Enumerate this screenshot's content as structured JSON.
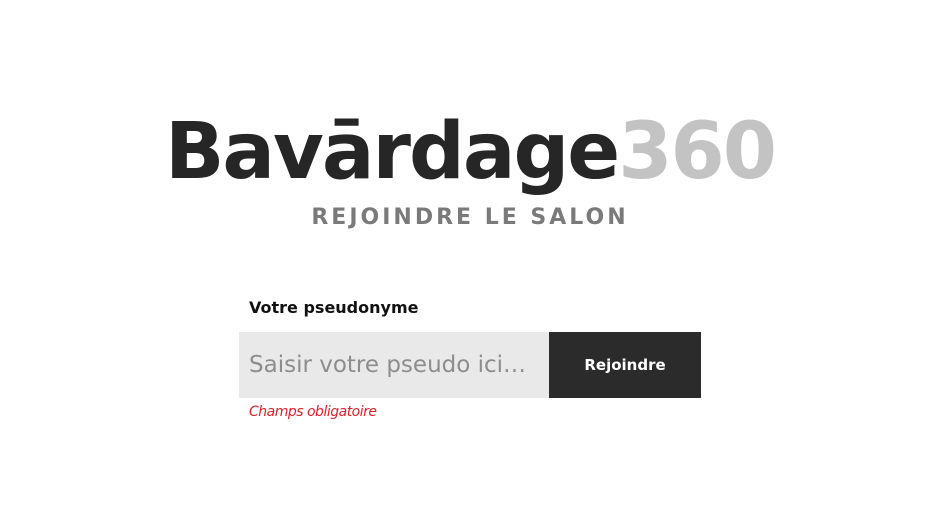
{
  "brand": {
    "name": "Bavārdage",
    "number": "360"
  },
  "subtitle": "REJOINDRE LE SALON",
  "form": {
    "label": "Votre pseudonyme",
    "input_value": "",
    "input_placeholder": "Saisir votre pseudo ici…",
    "button_label": "Rejoindre",
    "error_message": "Champs obligatoire"
  },
  "colors": {
    "brand_dark": "#262626",
    "brand_light": "#c3c3c3",
    "button_bg": "#2b2b2b",
    "input_bg": "#e9e9e9",
    "error": "#e0202a"
  }
}
